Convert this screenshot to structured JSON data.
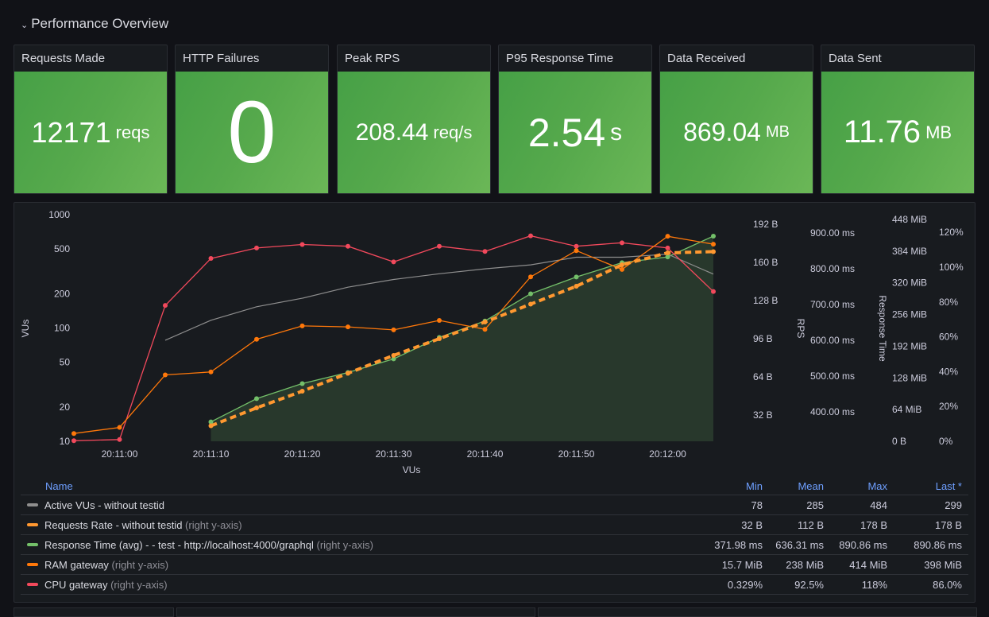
{
  "row": {
    "title": "Performance Overview"
  },
  "stats": [
    {
      "title": "Requests Made",
      "value": "12171",
      "unit": "reqs"
    },
    {
      "title": "HTTP Failures",
      "value": "0",
      "unit": ""
    },
    {
      "title": "Peak RPS",
      "value": "208.44",
      "unit": "req/s"
    },
    {
      "title": "P95 Response Time",
      "value": "2.54",
      "unit": "s"
    },
    {
      "title": "Data Received",
      "value": "869.04",
      "unit": "MB"
    },
    {
      "title": "Data Sent",
      "value": "11.76",
      "unit": "MB"
    }
  ],
  "colors": {
    "stat_green": "#56a94c",
    "vus": "#8e8e8e",
    "requests": "#ff9830",
    "response": "#73bf69",
    "ram": "#ff780a",
    "cpu": "#f2495c",
    "legend_header": "#6e9fff"
  },
  "chart_data": {
    "type": "line",
    "xlabel": "VUs",
    "x": [
      "20:10:55",
      "20:11:00",
      "20:11:05",
      "20:11:10",
      "20:11:15",
      "20:11:20",
      "20:11:25",
      "20:11:30",
      "20:11:35",
      "20:11:40",
      "20:11:45",
      "20:11:50",
      "20:11:55",
      "20:12:00",
      "20:12:05"
    ],
    "x_ticks": [
      "20:11:00",
      "20:11:10",
      "20:11:20",
      "20:11:30",
      "20:11:40",
      "20:11:50",
      "20:12:00"
    ],
    "axes": [
      {
        "id": "vus",
        "label": "VUs",
        "side": "left",
        "scale": "log",
        "ticks": [
          "10",
          "20",
          "50",
          "100",
          "200",
          "500",
          "1000"
        ],
        "range": [
          10,
          1000
        ]
      },
      {
        "id": "bytes",
        "label": "RPS",
        "side": "right",
        "ticks": [
          "32 B",
          "64 B",
          "96 B",
          "128 B",
          "160 B",
          "192 B"
        ],
        "range": [
          0,
          200
        ]
      },
      {
        "id": "ms",
        "label": "Response Time",
        "side": "right",
        "ticks": [
          "400.00 ms",
          "500.00 ms",
          "600.00 ms",
          "700.00 ms",
          "800.00 ms",
          "900.00 ms"
        ],
        "range": [
          340,
          950
        ]
      },
      {
        "id": "mib",
        "label": "",
        "side": "right",
        "ticks": [
          "0 B",
          "64 MiB",
          "128 MiB",
          "192 MiB",
          "256 MiB",
          "320 MiB",
          "384 MiB",
          "448 MiB"
        ],
        "range": [
          0,
          448
        ]
      },
      {
        "id": "pct",
        "label": "",
        "side": "right",
        "ticks": [
          "0%",
          "20%",
          "40%",
          "60%",
          "80%",
          "100%",
          "120%"
        ],
        "range": [
          0,
          120
        ]
      }
    ],
    "series": [
      {
        "name": "Active VUs - without testid",
        "axis": "vus",
        "color": "#8e8e8e",
        "style": "line",
        "values": [
          null,
          null,
          78,
          117,
          154,
          183,
          229,
          268,
          301,
          333,
          361,
          421,
          421,
          448,
          299
        ]
      },
      {
        "name": "Requests Rate - without testid",
        "axis": "bytes",
        "color": "#ff9830",
        "style": "dashed",
        "values": [
          null,
          null,
          null,
          23,
          38,
          52,
          67,
          82,
          96,
          110,
          125,
          140,
          158,
          168,
          169
        ]
      },
      {
        "name": "Response Time (avg) - - test - http://localhost:4000/graphql",
        "axis": "ms",
        "color": "#73bf69",
        "style": "area",
        "values": [
          null,
          null,
          null,
          372,
          437,
          479,
          510,
          548,
          608,
          654,
          730,
          777,
          817,
          833,
          891
        ]
      },
      {
        "name": "RAM gateway",
        "axis": "mib",
        "color": "#ff780a",
        "style": "line",
        "values": [
          15.7,
          28,
          134,
          140,
          206,
          233,
          231,
          225,
          244,
          226,
          332,
          385,
          347,
          414,
          398
        ]
      },
      {
        "name": "CPU gateway",
        "axis": "pct",
        "color": "#f2495c",
        "style": "line",
        "values": [
          0.329,
          1,
          78,
          105,
          111,
          113,
          112,
          103,
          112,
          109,
          118,
          112,
          114,
          111,
          86
        ]
      }
    ]
  },
  "legend": {
    "headers": {
      "name": "Name",
      "min": "Min",
      "mean": "Mean",
      "max": "Max",
      "last": "Last *"
    },
    "rows": [
      {
        "label": "Active VUs - without testid",
        "suffix": "",
        "color": "#8e8e8e",
        "min": "78",
        "mean": "285",
        "max": "484",
        "last": "299"
      },
      {
        "label": "Requests Rate - without testid",
        "suffix": " (right y-axis)",
        "color": "#ff9830",
        "min": "32 B",
        "mean": "112 B",
        "max": "178 B",
        "last": "178 B"
      },
      {
        "label": "Response Time (avg) - - test - http://localhost:4000/graphql",
        "suffix": " (right y-axis)",
        "color": "#73bf69",
        "min": "371.98 ms",
        "mean": "636.31 ms",
        "max": "890.86 ms",
        "last": "890.86 ms"
      },
      {
        "label": "RAM gateway",
        "suffix": " (right y-axis)",
        "color": "#ff780a",
        "min": "15.7 MiB",
        "mean": "238 MiB",
        "max": "414 MiB",
        "last": "398 MiB"
      },
      {
        "label": "CPU gateway",
        "suffix": " (right y-axis)",
        "color": "#f2495c",
        "min": "0.329%",
        "mean": "92.5%",
        "max": "118%",
        "last": "86.0%"
      }
    ]
  }
}
